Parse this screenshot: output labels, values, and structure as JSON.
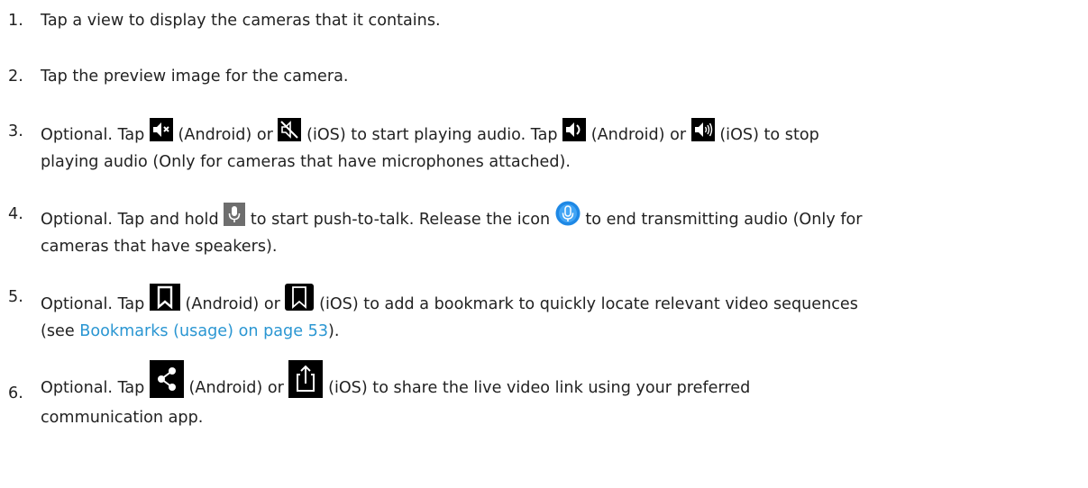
{
  "steps": [
    {
      "number": "1.",
      "text": "Tap a view to display the cameras that it contains."
    },
    {
      "number": "2.",
      "text": "Tap the preview image for the camera."
    },
    {
      "number": "3.",
      "parts": [
        "Optional. Tap",
        "(Android) or",
        "(iOS) to start playing audio. Tap",
        "(Android) or",
        "(iOS) to stop",
        "playing audio (Only for cameras that have microphones attached)."
      ],
      "icons": [
        "speaker-muted-android-icon",
        "speaker-muted-ios-icon",
        "speaker-on-android-icon",
        "speaker-on-ios-icon"
      ]
    },
    {
      "number": "4.",
      "parts": [
        "Optional. Tap and hold",
        "to start push-to-talk. Release the icon",
        "to end transmitting audio (Only for",
        "cameras that have speakers)."
      ],
      "icons": [
        "microphone-icon",
        "microphone-active-icon"
      ]
    },
    {
      "number": "5.",
      "parts": [
        "Optional. Tap",
        "(Android) or",
        "(iOS) to add a bookmark to quickly locate relevant video sequences",
        "(see",
        "Bookmarks (usage) on page 53",
        ")."
      ],
      "icons": [
        "bookmark-android-icon",
        "bookmark-ios-icon"
      ],
      "link_color": "#2a96d2"
    },
    {
      "number": "6.",
      "parts": [
        "Optional. Tap",
        "(Android) or",
        "(iOS) to share the live video link using your preferred",
        "communication app."
      ],
      "icons": [
        "share-android-icon",
        "share-ios-icon"
      ]
    }
  ],
  "colors": {
    "text": "#222222",
    "link": "#2a96d2",
    "icon_bg": "#000000",
    "mic_active": "#1e88e5"
  }
}
